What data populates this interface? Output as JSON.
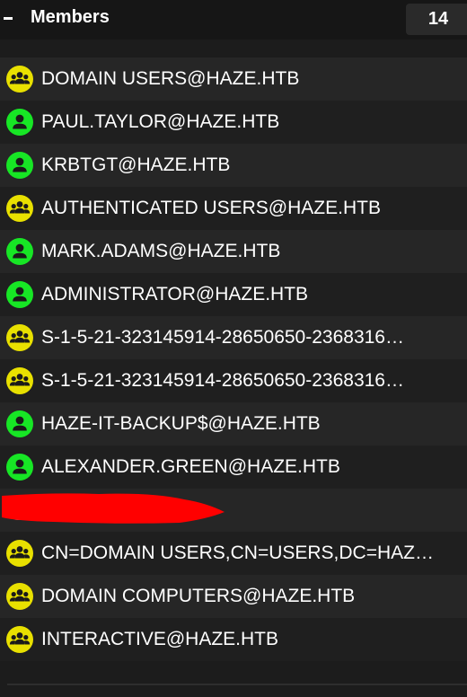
{
  "header": {
    "title": "Members",
    "count": "14"
  },
  "colors": {
    "group_icon": "#e8e000",
    "user_icon": "#17e625",
    "redaction": "#ff0000"
  },
  "members": [
    {
      "type": "group",
      "icon": "group-icon",
      "label": "DOMAIN USERS@HAZE.HTB"
    },
    {
      "type": "user",
      "icon": "user-icon",
      "label": "PAUL.TAYLOR@HAZE.HTB"
    },
    {
      "type": "user",
      "icon": "user-icon",
      "label": "KRBTGT@HAZE.HTB"
    },
    {
      "type": "group",
      "icon": "group-icon",
      "label": "AUTHENTICATED USERS@HAZE.HTB"
    },
    {
      "type": "user",
      "icon": "user-icon",
      "label": "MARK.ADAMS@HAZE.HTB"
    },
    {
      "type": "user",
      "icon": "user-icon",
      "label": "ADMINISTRATOR@HAZE.HTB"
    },
    {
      "type": "group",
      "icon": "group-icon",
      "label": "S-1-5-21-323145914-28650650-2368316…"
    },
    {
      "type": "group",
      "icon": "group-icon",
      "label": "S-1-5-21-323145914-28650650-2368316…"
    },
    {
      "type": "user",
      "icon": "user-icon",
      "label": "HAZE-IT-BACKUP$@HAZE.HTB"
    },
    {
      "type": "user",
      "icon": "user-icon",
      "label": "ALEXANDER.GREEN@HAZE.HTB"
    },
    {
      "type": "redacted",
      "icon": "redaction-mark",
      "label": ""
    },
    {
      "type": "group",
      "icon": "group-icon",
      "label": "CN=DOMAIN USERS,CN=USERS,DC=HAZ…"
    },
    {
      "type": "group",
      "icon": "group-icon",
      "label": "DOMAIN COMPUTERS@HAZE.HTB"
    },
    {
      "type": "group",
      "icon": "group-icon",
      "label": "INTERACTIVE@HAZE.HTB"
    }
  ]
}
